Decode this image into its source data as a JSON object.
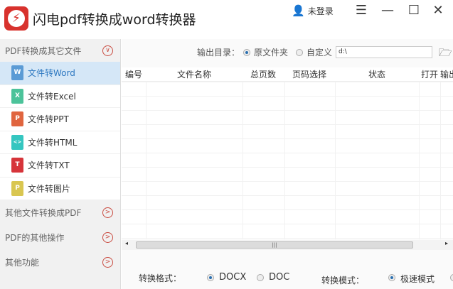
{
  "app": {
    "title": "闪电pdf转换成word转换器",
    "logo_glyph": "⚡",
    "user_label": "未登录"
  },
  "window": {
    "menu": "☰",
    "minimize": "—",
    "maximize": "☐",
    "close": "✕"
  },
  "sidebar": {
    "section_main": "PDF转换成其它文件",
    "items": [
      {
        "label": "文件转Word",
        "glyph": "W",
        "color": "#5b9bd5"
      },
      {
        "label": "文件转Excel",
        "glyph": "X",
        "color": "#4cc39a"
      },
      {
        "label": "文件转PPT",
        "glyph": "P",
        "color": "#e0653f"
      },
      {
        "label": "文件转HTML",
        "glyph": "<>",
        "color": "#35c6c0"
      },
      {
        "label": "文件转TXT",
        "glyph": "T",
        "color": "#d6343a"
      },
      {
        "label": "文件转图片",
        "glyph": "P",
        "color": "#d9c650"
      }
    ],
    "sections": [
      "其他文件转换成PDF",
      "PDF的其他操作",
      "其他功能"
    ]
  },
  "output": {
    "label": "输出目录：",
    "opt_original": "原文件夹",
    "opt_custom": "自定义",
    "path": "d:\\"
  },
  "table": {
    "columns": [
      "编号",
      "文件名称",
      "总页数",
      "页码选择",
      "状态",
      "打开",
      "输出"
    ]
  },
  "bottom": {
    "format_label": "转换格式：",
    "format_opts": [
      "DOCX",
      "DOC"
    ],
    "mode_label": "转换模式：",
    "mode_opts": [
      "极速模式"
    ]
  }
}
